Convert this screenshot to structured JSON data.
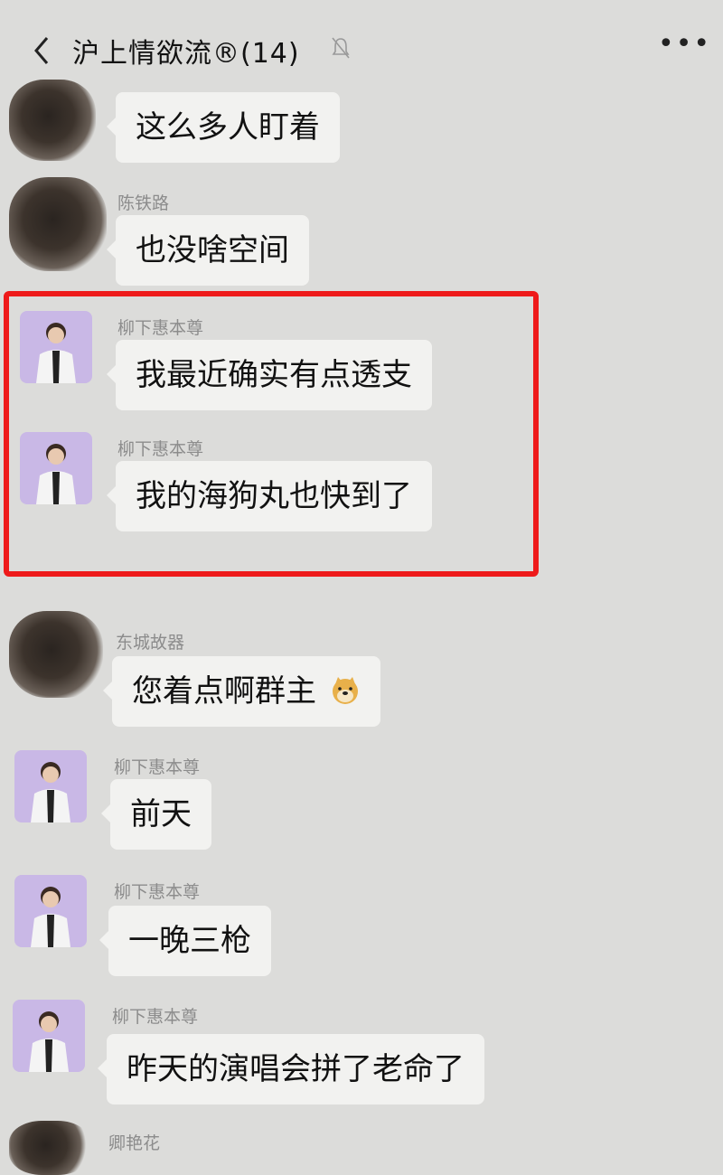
{
  "header": {
    "title": "沪上情欲流®(14)"
  },
  "timestamp": "",
  "messages": [
    {
      "sender": "",
      "text": "这么多人盯着",
      "avatar": "blurred"
    },
    {
      "sender": "陈铁路",
      "text": "也没啥空间",
      "avatar": "blurred"
    },
    {
      "sender": "柳下惠本尊",
      "text": "我最近确实有点透支",
      "avatar": "purple-person"
    },
    {
      "sender": "柳下惠本尊",
      "text": "我的海狗丸也快到了",
      "avatar": "purple-person"
    },
    {
      "sender": "东城故器",
      "text": "您着点啊群主",
      "avatar": "blurred",
      "emoji": "doge-icon"
    },
    {
      "sender": "柳下惠本尊",
      "text": "前天",
      "avatar": "purple-person"
    },
    {
      "sender": "柳下惠本尊",
      "text": "一晚三枪",
      "avatar": "purple-person"
    },
    {
      "sender": "柳下惠本尊",
      "text": "昨天的演唱会拼了老命了",
      "avatar": "purple-person"
    },
    {
      "sender": "卿艳花",
      "text": "",
      "avatar": "blurred"
    }
  ],
  "colors": {
    "background": "#dcdcda",
    "bubble": "#f2f2f0",
    "highlight": "#ee1a1a",
    "avatar_purple": "#c9b8e6"
  }
}
